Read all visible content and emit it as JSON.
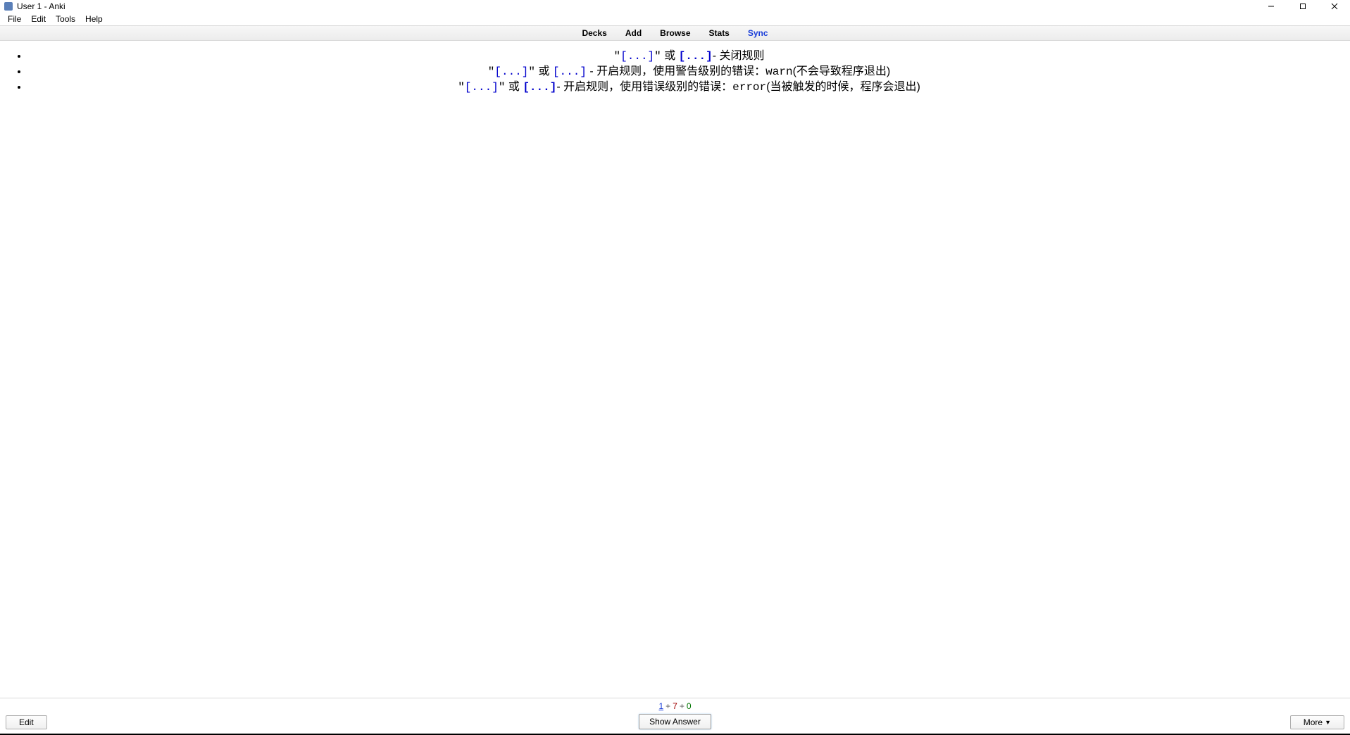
{
  "window": {
    "title": "User 1 - Anki"
  },
  "menubar": {
    "items": [
      "File",
      "Edit",
      "Tools",
      "Help"
    ]
  },
  "toolbar": {
    "items": [
      {
        "label": "Decks",
        "active": false
      },
      {
        "label": "Add",
        "active": false
      },
      {
        "label": "Browse",
        "active": false
      },
      {
        "label": "Stats",
        "active": false
      },
      {
        "label": "Sync",
        "active": true
      }
    ]
  },
  "card": {
    "lines": [
      {
        "q1": "\"",
        "code1": "[...]",
        "q2": "\"",
        "sep": " 或 ",
        "code2": "[...]",
        "tail": "- 关闭规则"
      },
      {
        "q1": "\"",
        "code1": "[...]",
        "q2": "\"",
        "sep": " 或 ",
        "code2": "[...]",
        "tail_prefix": " - 开启规则，使用警告级别的错误：",
        "mono": "warn",
        "tail_suffix": "(不会导致程序退出)"
      },
      {
        "q1": "\"",
        "code1": "[...]",
        "q2": "\"",
        "sep": " 或 ",
        "code2": "[...]",
        "tail_prefix": "- 开启规则，使用错误级别的错误：",
        "mono": "error",
        "tail_suffix": "(当被触发的时候，程序会退出)"
      }
    ]
  },
  "bottom": {
    "count_new": "1",
    "count_plus1": "+",
    "count_learn": "7",
    "count_plus2": "+",
    "count_due": "0",
    "show_answer": "Show Answer",
    "edit": "Edit",
    "more": "More"
  }
}
